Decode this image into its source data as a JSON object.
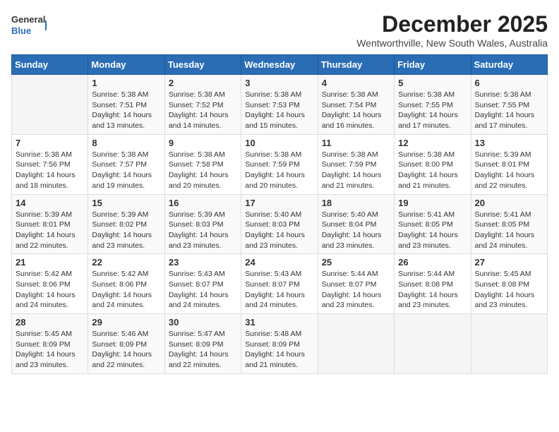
{
  "logo": {
    "general": "General",
    "blue": "Blue"
  },
  "title": "December 2025",
  "subtitle": "Wentworthville, New South Wales, Australia",
  "days_header": [
    "Sunday",
    "Monday",
    "Tuesday",
    "Wednesday",
    "Thursday",
    "Friday",
    "Saturday"
  ],
  "weeks": [
    [
      {
        "day": "",
        "info": ""
      },
      {
        "day": "1",
        "info": "Sunrise: 5:38 AM\nSunset: 7:51 PM\nDaylight: 14 hours\nand 13 minutes."
      },
      {
        "day": "2",
        "info": "Sunrise: 5:38 AM\nSunset: 7:52 PM\nDaylight: 14 hours\nand 14 minutes."
      },
      {
        "day": "3",
        "info": "Sunrise: 5:38 AM\nSunset: 7:53 PM\nDaylight: 14 hours\nand 15 minutes."
      },
      {
        "day": "4",
        "info": "Sunrise: 5:38 AM\nSunset: 7:54 PM\nDaylight: 14 hours\nand 16 minutes."
      },
      {
        "day": "5",
        "info": "Sunrise: 5:38 AM\nSunset: 7:55 PM\nDaylight: 14 hours\nand 17 minutes."
      },
      {
        "day": "6",
        "info": "Sunrise: 5:38 AM\nSunset: 7:55 PM\nDaylight: 14 hours\nand 17 minutes."
      }
    ],
    [
      {
        "day": "7",
        "info": "Sunrise: 5:38 AM\nSunset: 7:56 PM\nDaylight: 14 hours\nand 18 minutes."
      },
      {
        "day": "8",
        "info": "Sunrise: 5:38 AM\nSunset: 7:57 PM\nDaylight: 14 hours\nand 19 minutes."
      },
      {
        "day": "9",
        "info": "Sunrise: 5:38 AM\nSunset: 7:58 PM\nDaylight: 14 hours\nand 20 minutes."
      },
      {
        "day": "10",
        "info": "Sunrise: 5:38 AM\nSunset: 7:59 PM\nDaylight: 14 hours\nand 20 minutes."
      },
      {
        "day": "11",
        "info": "Sunrise: 5:38 AM\nSunset: 7:59 PM\nDaylight: 14 hours\nand 21 minutes."
      },
      {
        "day": "12",
        "info": "Sunrise: 5:38 AM\nSunset: 8:00 PM\nDaylight: 14 hours\nand 21 minutes."
      },
      {
        "day": "13",
        "info": "Sunrise: 5:39 AM\nSunset: 8:01 PM\nDaylight: 14 hours\nand 22 minutes."
      }
    ],
    [
      {
        "day": "14",
        "info": "Sunrise: 5:39 AM\nSunset: 8:01 PM\nDaylight: 14 hours\nand 22 minutes."
      },
      {
        "day": "15",
        "info": "Sunrise: 5:39 AM\nSunset: 8:02 PM\nDaylight: 14 hours\nand 23 minutes."
      },
      {
        "day": "16",
        "info": "Sunrise: 5:39 AM\nSunset: 8:03 PM\nDaylight: 14 hours\nand 23 minutes."
      },
      {
        "day": "17",
        "info": "Sunrise: 5:40 AM\nSunset: 8:03 PM\nDaylight: 14 hours\nand 23 minutes."
      },
      {
        "day": "18",
        "info": "Sunrise: 5:40 AM\nSunset: 8:04 PM\nDaylight: 14 hours\nand 23 minutes."
      },
      {
        "day": "19",
        "info": "Sunrise: 5:41 AM\nSunset: 8:05 PM\nDaylight: 14 hours\nand 23 minutes."
      },
      {
        "day": "20",
        "info": "Sunrise: 5:41 AM\nSunset: 8:05 PM\nDaylight: 14 hours\nand 24 minutes."
      }
    ],
    [
      {
        "day": "21",
        "info": "Sunrise: 5:42 AM\nSunset: 8:06 PM\nDaylight: 14 hours\nand 24 minutes."
      },
      {
        "day": "22",
        "info": "Sunrise: 5:42 AM\nSunset: 8:06 PM\nDaylight: 14 hours\nand 24 minutes."
      },
      {
        "day": "23",
        "info": "Sunrise: 5:43 AM\nSunset: 8:07 PM\nDaylight: 14 hours\nand 24 minutes."
      },
      {
        "day": "24",
        "info": "Sunrise: 5:43 AM\nSunset: 8:07 PM\nDaylight: 14 hours\nand 24 minutes."
      },
      {
        "day": "25",
        "info": "Sunrise: 5:44 AM\nSunset: 8:07 PM\nDaylight: 14 hours\nand 23 minutes."
      },
      {
        "day": "26",
        "info": "Sunrise: 5:44 AM\nSunset: 8:08 PM\nDaylight: 14 hours\nand 23 minutes."
      },
      {
        "day": "27",
        "info": "Sunrise: 5:45 AM\nSunset: 8:08 PM\nDaylight: 14 hours\nand 23 minutes."
      }
    ],
    [
      {
        "day": "28",
        "info": "Sunrise: 5:45 AM\nSunset: 8:09 PM\nDaylight: 14 hours\nand 23 minutes."
      },
      {
        "day": "29",
        "info": "Sunrise: 5:46 AM\nSunset: 8:09 PM\nDaylight: 14 hours\nand 22 minutes."
      },
      {
        "day": "30",
        "info": "Sunrise: 5:47 AM\nSunset: 8:09 PM\nDaylight: 14 hours\nand 22 minutes."
      },
      {
        "day": "31",
        "info": "Sunrise: 5:48 AM\nSunset: 8:09 PM\nDaylight: 14 hours\nand 21 minutes."
      },
      {
        "day": "",
        "info": ""
      },
      {
        "day": "",
        "info": ""
      },
      {
        "day": "",
        "info": ""
      }
    ]
  ]
}
